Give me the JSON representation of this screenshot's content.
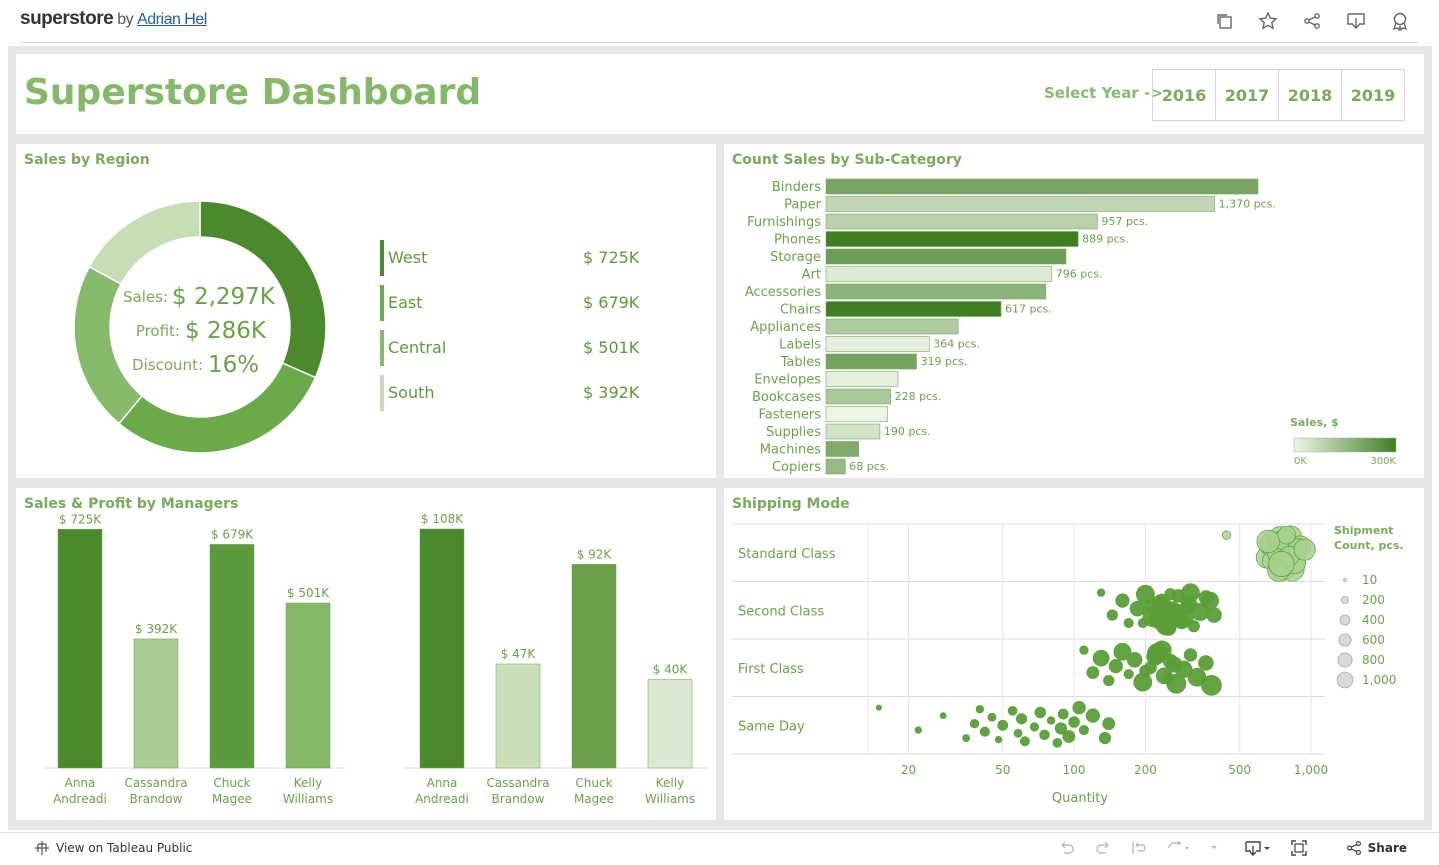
{
  "header": {
    "brand": "superstore",
    "by": "by",
    "author": "Adrian Hel",
    "icons": [
      "copy-icon",
      "star-icon",
      "share-icon",
      "download-icon",
      "award-icon"
    ]
  },
  "dashboard": {
    "title": "Superstore Dashboard",
    "year_select_label": "Select Year ->",
    "years": [
      "2016",
      "2017",
      "2018",
      "2019"
    ]
  },
  "region": {
    "title": "Sales by Region",
    "center": {
      "sales_label": "Sales:",
      "sales_value": "$ 2,297K",
      "profit_label": "Profit:",
      "profit_value": "$ 286K",
      "discount_label": "Discount:",
      "discount_value": "16%"
    },
    "items": [
      {
        "name": "West",
        "label": "$ 725K",
        "value": 725,
        "color": "#4a8a2c"
      },
      {
        "name": "East",
        "label": "$ 679K",
        "value": 679,
        "color": "#6aaa48"
      },
      {
        "name": "Central",
        "label": "$ 501K",
        "value": 501,
        "color": "#86bb6c"
      },
      {
        "name": "South",
        "label": "$ 392K",
        "value": 392,
        "color": "#c5deb5"
      }
    ]
  },
  "subcat": {
    "title": "Count Sales by Sub-Category",
    "legend_title": "Sales, $",
    "legend_min": "0K",
    "legend_max": "300K",
    "chart_data": {
      "type": "bar",
      "orientation": "horizontal",
      "categories": [
        "Binders",
        "Paper",
        "Furnishings",
        "Phones",
        "Storage",
        "Art",
        "Accessories",
        "Chairs",
        "Appliances",
        "Labels",
        "Tables",
        "Envelopes",
        "Bookcases",
        "Fasteners",
        "Supplies",
        "Machines",
        "Copiers"
      ],
      "values": [
        1523,
        1370,
        957,
        889,
        846,
        796,
        775,
        617,
        466,
        364,
        319,
        254,
        228,
        217,
        190,
        115,
        68
      ],
      "labels": [
        "",
        "1,370 pcs.",
        "957 pcs.",
        "889 pcs.",
        "",
        "796 pcs.",
        "",
        "617 pcs.",
        "",
        "364 pcs.",
        "319 pcs.",
        "",
        "228 pcs.",
        "",
        "190 pcs.",
        "",
        "68 pcs."
      ],
      "color_sales_k": [
        203,
        78,
        92,
        330,
        224,
        27,
        167,
        328,
        107,
        12,
        207,
        16,
        115,
        3,
        47,
        189,
        150
      ]
    }
  },
  "managers": {
    "title": "Sales & Profit by Managers",
    "chart_data": [
      {
        "type": "bar",
        "measure": "Sales",
        "categories": [
          "Anna Andreadi",
          "Cassandra Brandow",
          "Chuck Magee",
          "Kelly Williams"
        ],
        "values": [
          725,
          392,
          679,
          501
        ],
        "labels": [
          "$ 725K",
          "$ 392K",
          "$ 679K",
          "$ 501K"
        ],
        "ylim": [
          0,
          820
        ]
      },
      {
        "type": "bar",
        "measure": "Profit",
        "categories": [
          "Anna Andreadi",
          "Cassandra Brandow",
          "Chuck Magee",
          "Kelly Williams"
        ],
        "values": [
          108,
          47,
          92,
          40
        ],
        "labels": [
          "$ 108K",
          "$ 47K",
          "$ 92K",
          "$ 40K"
        ],
        "ylim": [
          0,
          122
        ]
      }
    ],
    "name_lines": [
      [
        "Anna",
        "Andreadi"
      ],
      [
        "Cassandra",
        "Brandow"
      ],
      [
        "Chuck",
        "Magee"
      ],
      [
        "Kelly",
        "Williams"
      ]
    ]
  },
  "shipping": {
    "title": "Shipping Mode",
    "xlabel": "Quantity",
    "size_legend_title": [
      "Shipment",
      "Count, pcs."
    ],
    "size_legend": [
      "10",
      "200",
      "400",
      "600",
      "800",
      "1,000"
    ],
    "chart_data": {
      "type": "scatter",
      "xscale": "log",
      "xticks": [
        20,
        50,
        100,
        200,
        500,
        1000
      ],
      "xtick_labels": [
        "20",
        "50",
        "100",
        "200",
        "500",
        "1,000"
      ],
      "categories": [
        "Standard Class",
        "Second Class",
        "First Class",
        "Same Day"
      ],
      "points": {
        "Standard Class": [
          [
            440,
            10
          ],
          [
            650,
            60
          ],
          [
            700,
            80
          ],
          [
            780,
            70
          ],
          [
            720,
            50
          ],
          [
            820,
            65
          ],
          [
            860,
            55
          ],
          [
            690,
            90
          ],
          [
            760,
            95
          ],
          [
            800,
            40
          ],
          [
            740,
            75
          ],
          [
            680,
            45
          ],
          [
            900,
            60
          ],
          [
            830,
            85
          ],
          [
            710,
            35
          ],
          [
            770,
            58
          ],
          [
            850,
            72
          ],
          [
            880,
            48
          ],
          [
            730,
            66
          ],
          [
            810,
            52
          ],
          [
            660,
            70
          ],
          [
            750,
            88
          ],
          [
            940,
            62
          ],
          [
            790,
            44
          ]
        ],
        "Second Class": [
          [
            130,
            8
          ],
          [
            145,
            15
          ],
          [
            160,
            25
          ],
          [
            170,
            12
          ],
          [
            185,
            30
          ],
          [
            200,
            45
          ],
          [
            215,
            55
          ],
          [
            230,
            28
          ],
          [
            245,
            60
          ],
          [
            260,
            40
          ],
          [
            275,
            22
          ],
          [
            290,
            50
          ],
          [
            305,
            35
          ],
          [
            320,
            18
          ],
          [
            340,
            42
          ],
          [
            360,
            26
          ],
          [
            225,
            38
          ],
          [
            210,
            20
          ],
          [
            250,
            32
          ],
          [
            270,
            48
          ],
          [
            235,
            14
          ],
          [
            285,
            30
          ],
          [
            300,
            24
          ],
          [
            310,
            44
          ],
          [
            390,
            30
          ],
          [
            375,
            40
          ],
          [
            195,
            12
          ],
          [
            240,
            50
          ],
          [
            255,
            18
          ]
        ],
        "First Class": [
          [
            110,
            10
          ],
          [
            120,
            20
          ],
          [
            130,
            35
          ],
          [
            140,
            15
          ],
          [
            150,
            25
          ],
          [
            160,
            40
          ],
          [
            170,
            12
          ],
          [
            180,
            30
          ],
          [
            195,
            45
          ],
          [
            210,
            20
          ],
          [
            225,
            55
          ],
          [
            240,
            35
          ],
          [
            255,
            28
          ],
          [
            270,
            50
          ],
          [
            290,
            38
          ],
          [
            310,
            22
          ],
          [
            330,
            44
          ],
          [
            360,
            30
          ],
          [
            380,
            55
          ],
          [
            200,
            18
          ],
          [
            220,
            40
          ],
          [
            250,
            15
          ],
          [
            265,
            32
          ],
          [
            235,
            48
          ]
        ],
        "Same Day": [
          [
            15,
            4
          ],
          [
            22,
            6
          ],
          [
            28,
            5
          ],
          [
            35,
            7
          ],
          [
            38,
            10
          ],
          [
            40,
            8
          ],
          [
            42,
            12
          ],
          [
            45,
            9
          ],
          [
            48,
            6
          ],
          [
            50,
            14
          ],
          [
            55,
            11
          ],
          [
            58,
            9
          ],
          [
            60,
            15
          ],
          [
            62,
            12
          ],
          [
            68,
            10
          ],
          [
            72,
            16
          ],
          [
            75,
            13
          ],
          [
            80,
            8
          ],
          [
            85,
            11
          ],
          [
            88,
            18
          ],
          [
            90,
            14
          ],
          [
            95,
            20
          ],
          [
            100,
            16
          ],
          [
            105,
            22
          ],
          [
            110,
            12
          ],
          [
            120,
            25
          ],
          [
            135,
            18
          ],
          [
            140,
            20
          ]
        ]
      }
    }
  },
  "footer": {
    "view_label": "View on Tableau Public",
    "share_label": "Share"
  }
}
